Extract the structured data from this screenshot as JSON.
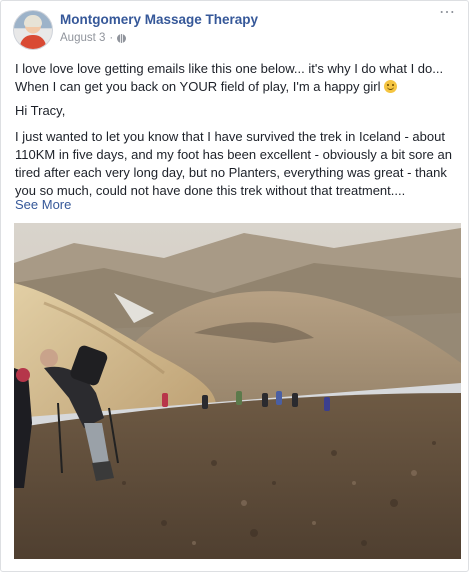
{
  "post": {
    "page_name": "Montgomery Massage Therapy",
    "date": "August 3",
    "separator": "·",
    "more_icon": "⋯",
    "avatar_icon": "page-profile-avatar",
    "privacy_icon": "globe-icon",
    "paragraphs": {
      "intro": "I love love love getting emails like this one below... it's why I do what I do... When I can get you back on YOUR field of play, I'm a happy girl",
      "greeting": "Hi Tracy,",
      "body": "I just wanted to let you know that I have survived the trek in Iceland - about 110KM in five days, and my foot has been excellent - obviously a bit sore an tired after each very long day, but no Planters, everything was great - thank you so much, could not have done this trek without that treatment...."
    },
    "see_more": "See More",
    "colors": {
      "link": "#365899",
      "text": "#1d2129",
      "meta": "#90949c"
    },
    "photo": {
      "subject": "hikers-climbing-volcanic-mountain-iceland"
    }
  }
}
